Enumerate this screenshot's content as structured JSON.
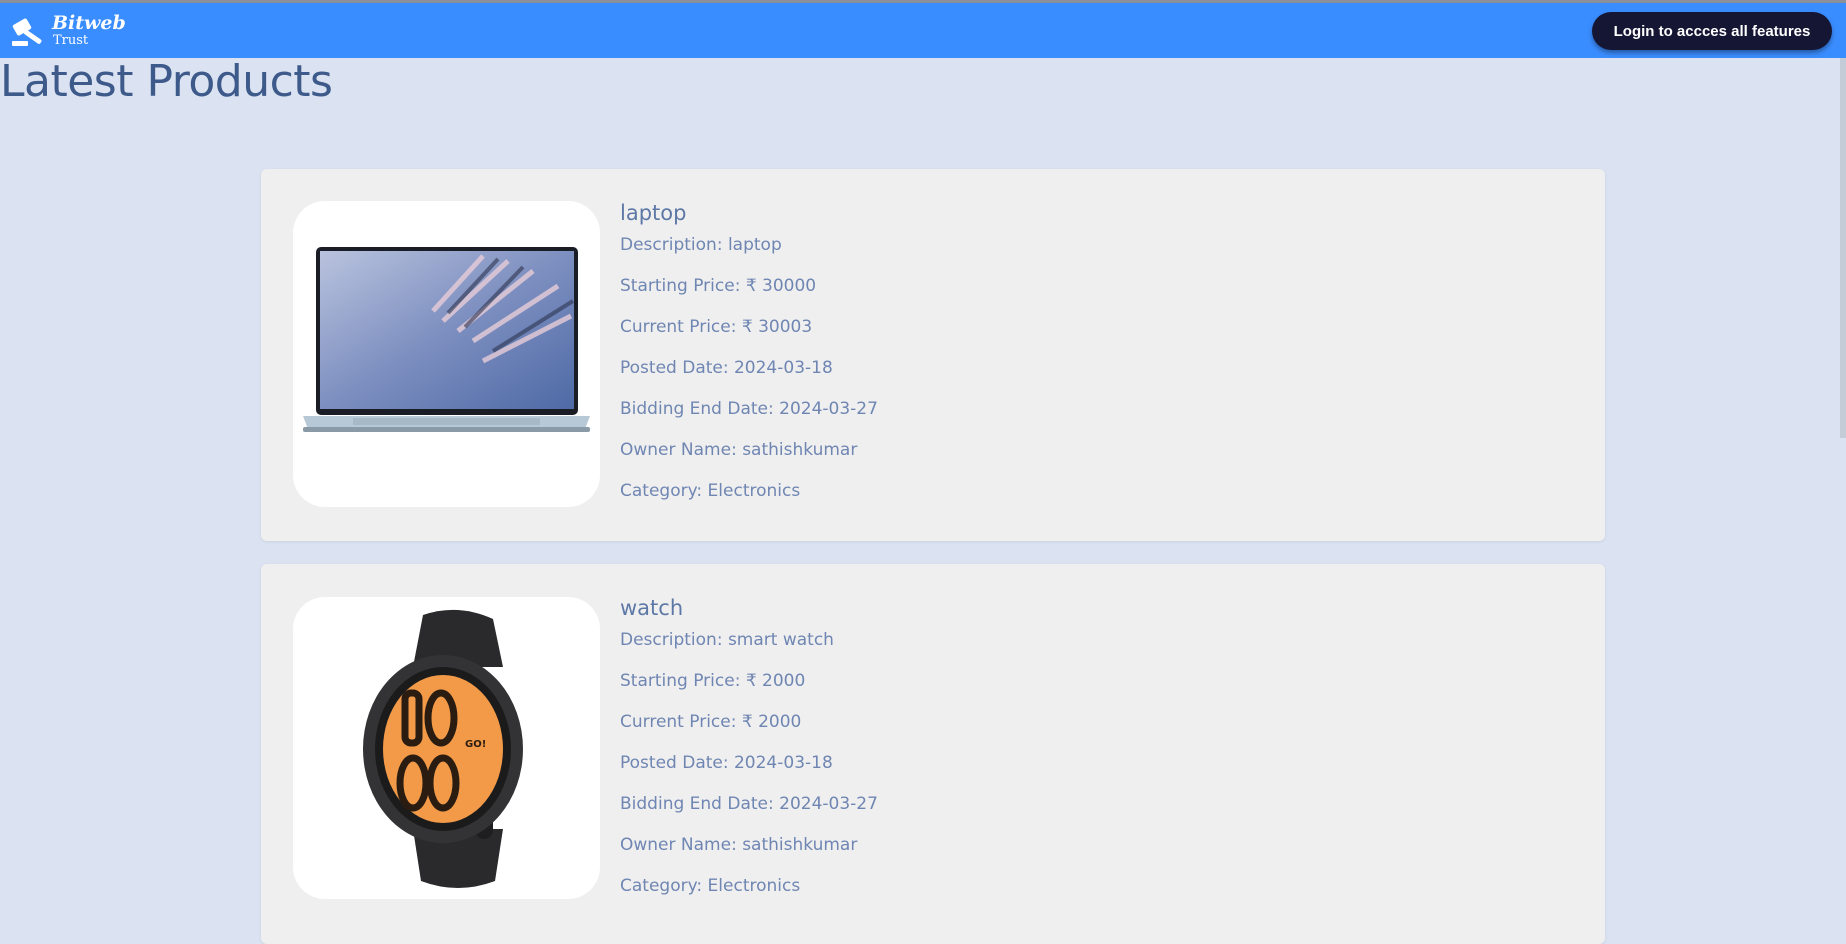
{
  "brand": {
    "name": "Bitweb",
    "tagline": "Trust"
  },
  "header": {
    "login_button": "Login to accces all features"
  },
  "page_title": "Latest Products",
  "products": [
    {
      "name": "laptop",
      "description": "Description: laptop",
      "starting_price": "Starting Price: ₹ 30000",
      "current_price": "Current Price: ₹ 30003",
      "posted_date": "Posted Date: 2024-03-18",
      "bidding_end": "Bidding End Date: 2024-03-27",
      "owner": "Owner Name: sathishkumar",
      "category": "Category: Electronics",
      "image": "laptop-photo"
    },
    {
      "name": "watch",
      "description": "Description: smart watch",
      "starting_price": "Starting Price: ₹ 2000",
      "current_price": "Current Price: ₹ 2000",
      "posted_date": "Posted Date: 2024-03-18",
      "bidding_end": "Bidding End Date: 2024-03-27",
      "owner": "Owner Name: sathishkumar",
      "category": "Category: Electronics",
      "image": "smartwatch-photo"
    }
  ],
  "colors": {
    "navbar": "#3a8dff",
    "background": "#dbe3f2",
    "card": "#efefef",
    "button": "#141633",
    "title": "#3d5a8a",
    "text": "#6f86b3"
  }
}
